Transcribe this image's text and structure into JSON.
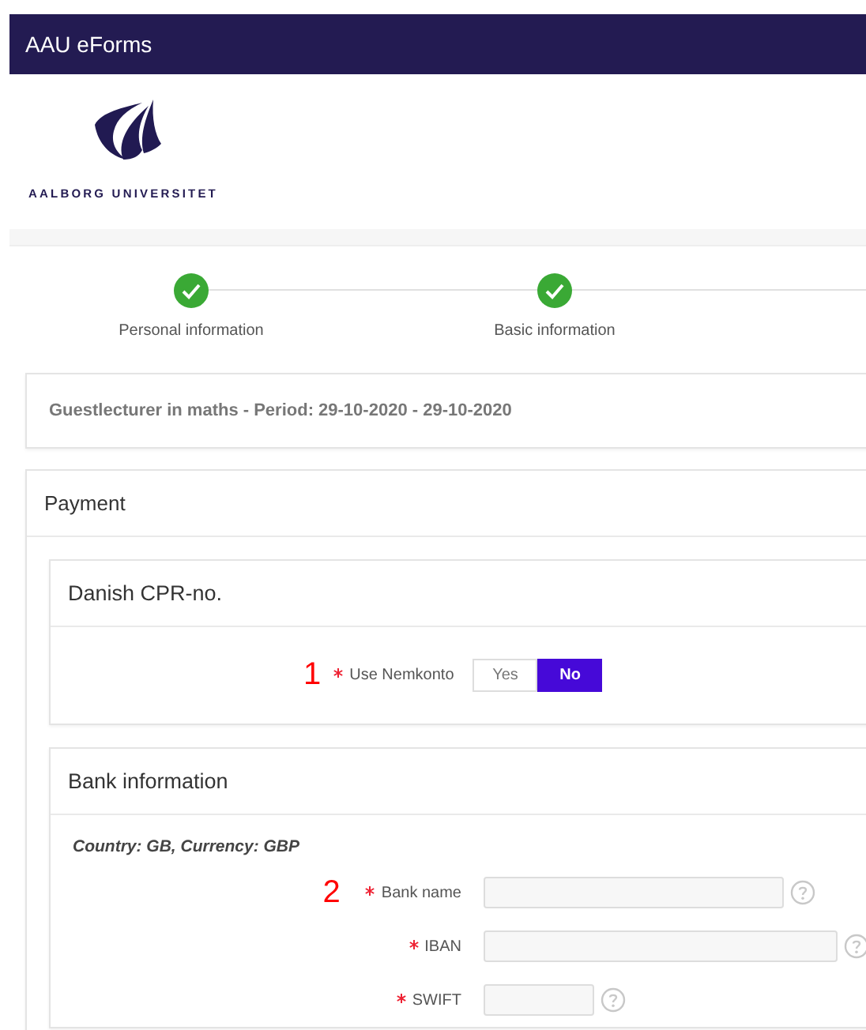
{
  "header": {
    "title": "AAU eForms"
  },
  "logo": {
    "wordmark": "AALBORG UNIVERSITET"
  },
  "steps": [
    {
      "label": "Personal information",
      "completed": true
    },
    {
      "label": "Basic information",
      "completed": true
    }
  ],
  "summary": "Guestlecturer in maths - Period: 29-10-2020 - 29-10-2020",
  "payment": {
    "title": "Payment",
    "cpr": {
      "title": "Danish CPR-no.",
      "marker": "1",
      "label": "Use Nemkonto",
      "required": true,
      "options": [
        {
          "label": "Yes",
          "selected": false
        },
        {
          "label": "No",
          "selected": true
        }
      ]
    },
    "bank": {
      "title": "Bank information",
      "note": "Country: GB, Currency: GBP",
      "fields": [
        {
          "marker": "2",
          "label": "Bank name",
          "required": true
        },
        {
          "label": "IBAN",
          "required": true
        },
        {
          "label": "SWIFT",
          "required": true
        }
      ]
    }
  }
}
